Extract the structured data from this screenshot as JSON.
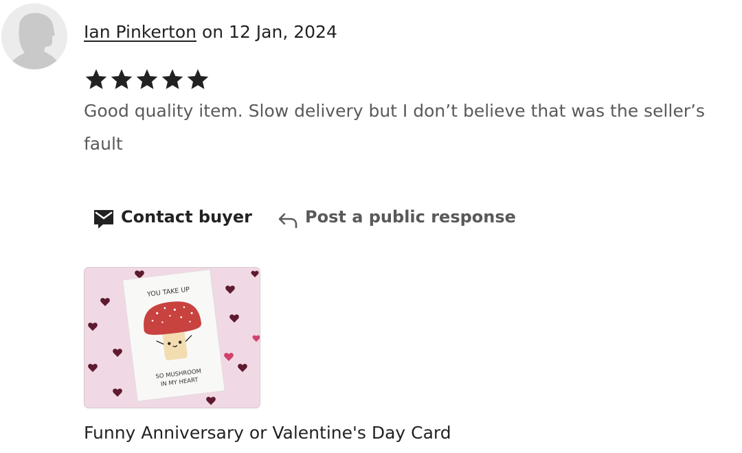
{
  "review": {
    "reviewer_name": "Ian Pinkerton",
    "date_text": "on 12 Jan, 2024",
    "rating": 5,
    "rating_max": 5,
    "text": "Good quality item. Slow delivery but I don’t believe that was the seller’s fault"
  },
  "actions": {
    "contact_label": "Contact buyer",
    "contact_icon": "mail-icon",
    "respond_label": "Post a public response",
    "respond_icon": "reply-arrow-icon"
  },
  "product": {
    "title": "Funny Anniversary or Valentine's Day Card",
    "card_text_top": "YOU TAKE UP",
    "card_text_bottom_1": "SO MUSHROOM",
    "card_text_bottom_2": "IN MY HEART"
  },
  "colors": {
    "text": "#222222",
    "muted_text": "#595959",
    "star": "#222222",
    "thumb_background": "#f0d9e4",
    "mushroom_cap": "#c8423f"
  }
}
